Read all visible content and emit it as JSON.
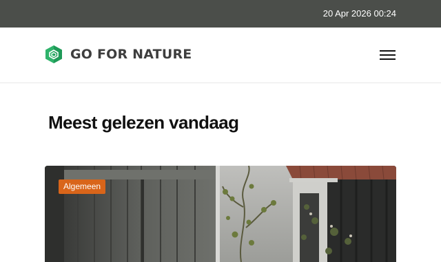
{
  "topbar": {
    "datetime": "20 Apr 2026 00:24"
  },
  "header": {
    "brand": "GO FOR NATURE",
    "logo_icon": "hexagon-leaf-logo",
    "menu_icon": "hamburger-menu-icon"
  },
  "main": {
    "section_title": "Meest gelezen vandaag",
    "featured": {
      "category": "Algemeen",
      "image": "photo-old-wooden-door-with-climbing-plants"
    }
  },
  "colors": {
    "topbar_bg": "#4b4e4a",
    "brand_green": "#2fb36b",
    "badge_orange": "#d9651a"
  }
}
